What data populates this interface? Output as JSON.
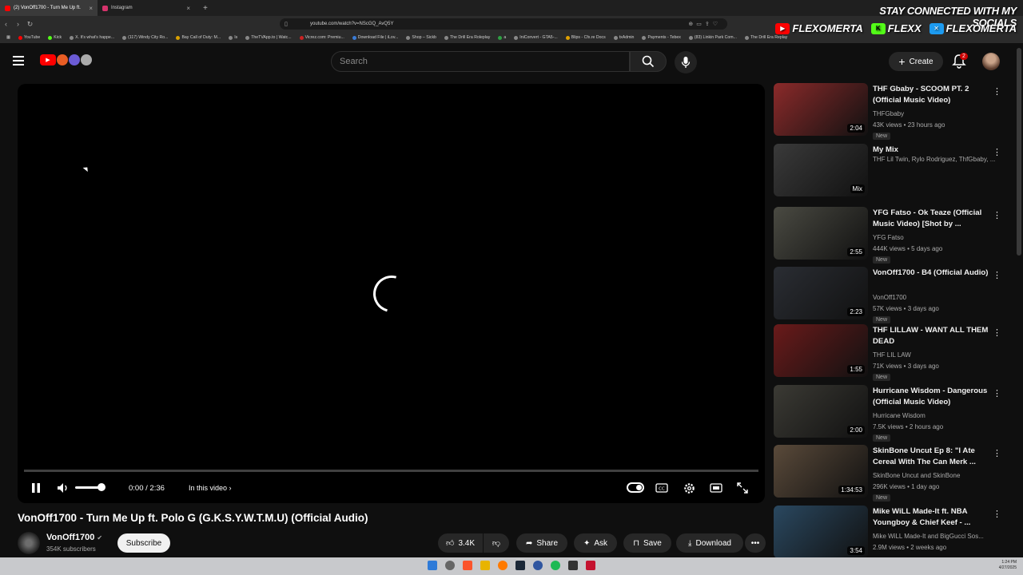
{
  "browser": {
    "tabs": [
      {
        "label": "(2) VonOff1700 - Turn Me Up ft.",
        "active": true
      },
      {
        "label": "Instagram",
        "active": false
      }
    ],
    "url": "youtube.com/watch?v=NScGQ_AvQ5Y",
    "bookmarks": [
      "YouTube",
      "Kick",
      "X. It's what's happe...",
      "(117) Windy City Ro...",
      "Bay Call of Duty: M...",
      "Is",
      "TheTVApp.to | Watc...",
      "Vicrez.com: Premiu...",
      "Download File | iLov...",
      "Shop – Sickb",
      "The Drill Era Roleplay",
      "a",
      "IniConvert - GTA5-...",
      "Blips - Cfx.re Docs",
      "txAdmin",
      "Payments - Tebex",
      "(83) Linkin Park Com...",
      "The Drill Era Replay"
    ]
  },
  "overlay": {
    "headline": "STAY CONNECTED WITH MY SOCIALS",
    "socials": [
      {
        "icon": "youtube-icon",
        "label": "FLEXOMERTA"
      },
      {
        "icon": "kick-icon",
        "label": "FLEXX"
      },
      {
        "icon": "x-icon",
        "label": "FLEXOMERTA"
      }
    ]
  },
  "header": {
    "search_placeholder": "Search",
    "create_label": "Create",
    "notif_count": "2"
  },
  "player": {
    "time": "0:00 / 2:36",
    "in_this_video": "In this video"
  },
  "video": {
    "title": "VonOff1700 - Turn Me Up ft. Polo G (G.K.S.Y.W.T.M.U) (Official Audio)",
    "channel": "VonOff1700",
    "subscribers": "354K subscribers",
    "subscribe_label": "Subscribe",
    "likes": "3.4K",
    "share_label": "Share",
    "ask_label": "Ask",
    "save_label": "Save",
    "download_label": "Download"
  },
  "recommendations": [
    {
      "title": "THF Gbaby - SCOOM PT. 2 (Official Music Video)",
      "channel": "THFGbaby",
      "meta": "43K views • 23 hours ago",
      "badge": "New",
      "duration": "2:04",
      "thumb": "#8b2a2a"
    },
    {
      "title": "My Mix",
      "channel": "THF Lil Twin, Rylo Rodriguez, ThfGbaby, ...",
      "meta": "",
      "badge": "",
      "duration": "Mix",
      "thumb": "#3a3a3a"
    },
    {
      "title": "YFG Fatso - Ok Teaze (Official Music Video) [Shot by ...",
      "channel": "YFG Fatso",
      "meta": "444K views • 5 days ago",
      "badge": "New",
      "duration": "2:55",
      "thumb": "#4a4a42"
    },
    {
      "title": "VonOff1700 - B4 (Official Audio)",
      "channel": "VonOff1700",
      "meta": "57K views • 3 days ago",
      "badge": "New",
      "duration": "2:23",
      "thumb": "#2a2d33"
    },
    {
      "title": "THF LILLAW - WANT ALL THEM DEAD",
      "channel": "THF LIL LAW",
      "meta": "71K views • 3 days ago",
      "badge": "New",
      "duration": "1:55",
      "thumb": "#6a1a1a"
    },
    {
      "title": "Hurricane Wisdom - Dangerous (Official Music Video)",
      "channel": "Hurricane Wisdom",
      "meta": "7.5K views • 2 hours ago",
      "badge": "New",
      "duration": "2:00",
      "thumb": "#3b3a34"
    },
    {
      "title": "SkinBone Uncut Ep 8: \"I Ate Cereal With The Can Merk ...",
      "channel": "SkinBone Uncut and SkinBone",
      "meta": "296K views • 1 day ago",
      "badge": "New",
      "duration": "1:34:53",
      "thumb": "#5a4a3a"
    },
    {
      "title": "Mike WiLL Made-It ft. NBA Youngboy & Chief Keef - ...",
      "channel": "Mike WiLL Made-It and BigGucci Sos...",
      "meta": "2.9M views • 2 weeks ago",
      "badge": "",
      "duration": "3:54",
      "thumb": "#2a4860"
    }
  ],
  "tray": {
    "time": "1:24 PM",
    "date": "4/27/2025"
  }
}
